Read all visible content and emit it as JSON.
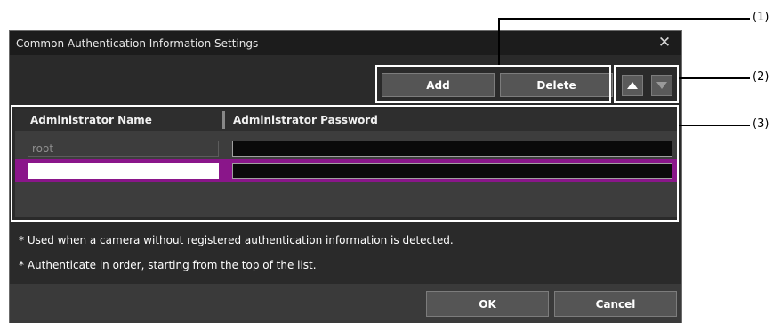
{
  "dialog": {
    "title": "Common Authentication Information Settings",
    "close_symbol": "✕"
  },
  "toolbar": {
    "add_label": "Add",
    "delete_label": "Delete",
    "up_icon": "triangle-up-icon",
    "down_icon": "triangle-down-icon"
  },
  "table": {
    "columns": [
      "Administrator Name",
      "Administrator Password"
    ],
    "rows": [
      {
        "name": "root",
        "password": "",
        "selected": false
      },
      {
        "name": "",
        "password": "",
        "selected": true
      }
    ]
  },
  "notes": [
    "* Used when a camera without registered authentication information is detected.",
    "* Authenticate in order, starting from the top of the list."
  ],
  "footer": {
    "ok_label": "OK",
    "cancel_label": "Cancel"
  },
  "callouts": [
    "(1)",
    "(2)",
    "(3)"
  ],
  "colors": {
    "dialog_bg": "#2a2a2a",
    "selected_row": "#8a168a",
    "button_bg": "#555555"
  }
}
